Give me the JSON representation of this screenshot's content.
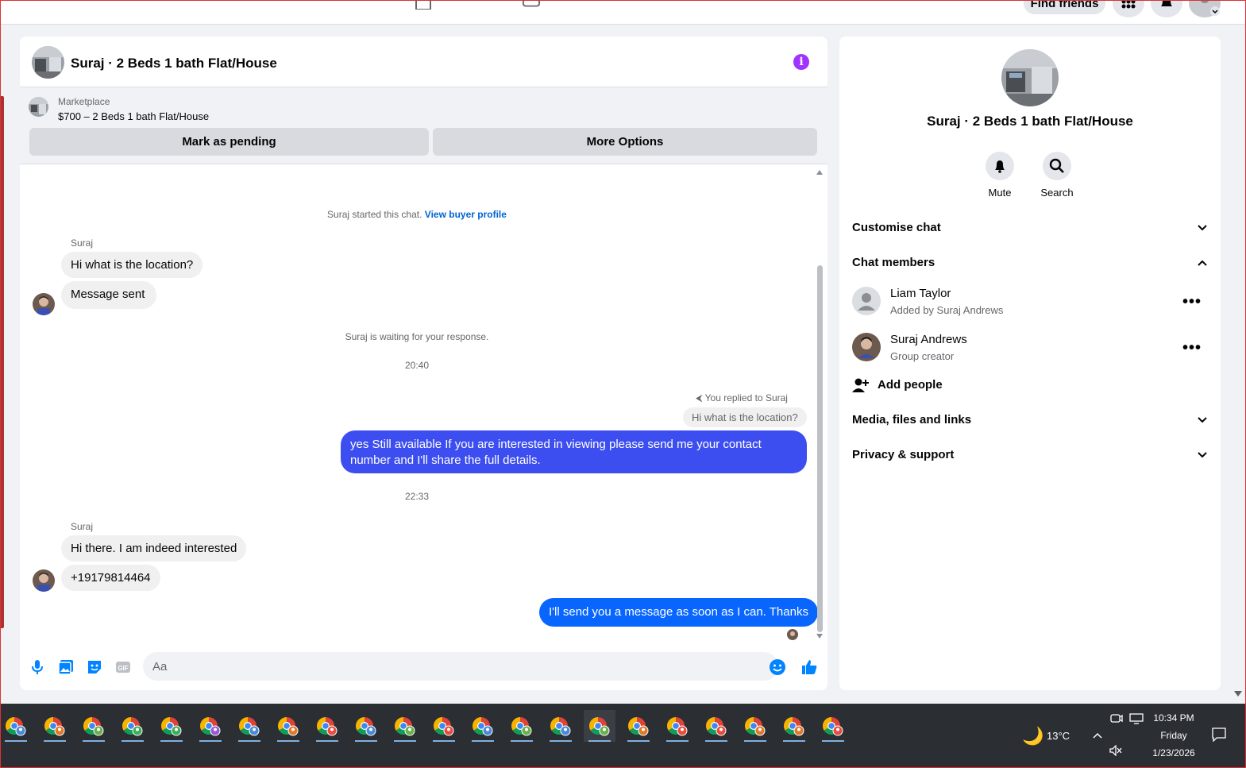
{
  "topbar": {
    "find_friends_label": "Find friends",
    "nav_icons": [
      "home-icon",
      "marketplace-icon"
    ],
    "right_buttons": [
      "menu-grid-icon",
      "notifications-icon",
      "account-avatar"
    ]
  },
  "chat": {
    "title": "Suraj · 2 Beds 1 bath Flat/House",
    "info_icon": "i",
    "marketplace": {
      "label": "Marketplace",
      "listing": "$700 – 2 Beds 1 bath Flat/House",
      "mark_pending_label": "Mark as pending",
      "more_options_label": "More Options"
    },
    "started_text": "Suraj started this chat.",
    "view_buyer_profile": "View buyer profile",
    "group1": {
      "sender": "Suraj",
      "messages": [
        "Hi what is the location?",
        "Message sent"
      ]
    },
    "waiting_text": "Suraj is waiting for your response.",
    "time1": "20:40",
    "replied_label": "You replied to Suraj",
    "quoted": "Hi what is the location?",
    "reply_message": "yes Still available If you are interested in viewing please send me your contact number and I'll share the full details.",
    "time2": "22:33",
    "group2": {
      "sender": "Suraj",
      "messages": [
        "Hi there. I am indeed interested",
        "+19179814464"
      ]
    },
    "outgoing_last": "I'll send you a message as soon as I can. Thanks",
    "composer_placeholder": "Aa",
    "colors": {
      "outgoing_bubble": "#0866ff",
      "reply_bubble": "#3d4ef0",
      "accent": "#0084ff"
    }
  },
  "details": {
    "title": "Suraj · 2 Beds 1 bath Flat/House",
    "mute_label": "Mute",
    "search_label": "Search",
    "customise_chat": "Customise chat",
    "chat_members": "Chat members",
    "members": [
      {
        "name": "Liam Taylor",
        "sub": "Added by Suraj Andrews"
      },
      {
        "name": "Suraj Andrews",
        "sub": "Group creator"
      }
    ],
    "add_people": "Add people",
    "media_files_links": "Media, files and links",
    "privacy_support": "Privacy & support"
  },
  "taskbar": {
    "app_count": 22,
    "weather_temp": "13°C",
    "time": "10:34 PM",
    "day": "Friday",
    "date": "1/23/2026"
  }
}
